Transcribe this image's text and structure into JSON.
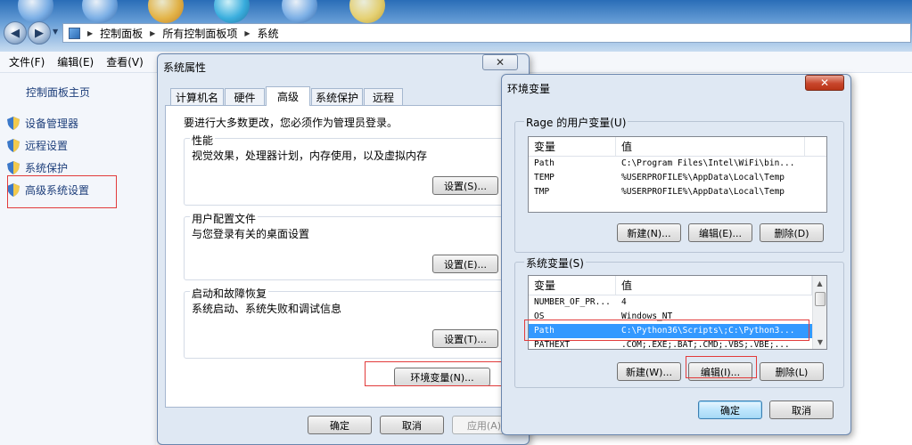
{
  "address_bar": {
    "crumbs": [
      "控制面板",
      "所有控制面板项",
      "系统"
    ]
  },
  "explorer": {
    "menu": [
      "文件(F)",
      "编辑(E)",
      "查看(V)"
    ],
    "sidebar": {
      "home": "控制面板主页",
      "links": [
        "设备管理器",
        "远程设置",
        "系统保护",
        "高级系统设置"
      ]
    }
  },
  "system_properties": {
    "title": "系统属性",
    "close_symbol": "✕",
    "tabs": [
      "计算机名",
      "硬件",
      "高级",
      "系统保护",
      "远程"
    ],
    "active_tab": "高级",
    "admin_note": "要进行大多数更改，您必须作为管理员登录。",
    "performance": {
      "title": "性能",
      "desc": "视觉效果，处理器计划，内存使用，以及虚拟内存",
      "button": "设置(S)..."
    },
    "user_profile": {
      "title": "用户配置文件",
      "desc": "与您登录有关的桌面设置",
      "button": "设置(E)..."
    },
    "startup": {
      "title": "启动和故障恢复",
      "desc": "系统启动、系统失败和调试信息",
      "button": "设置(T)..."
    },
    "env_button": "环境变量(N)...",
    "ok": "确定",
    "cancel": "取消",
    "apply": "应用(A)"
  },
  "env_vars": {
    "title": "环境变量",
    "close_symbol": "✕",
    "user_group": "Rage 的用户变量(U)",
    "columns": {
      "name": "变量",
      "value": "值"
    },
    "user_vars": [
      {
        "name": "Path",
        "value": "C:\\Program Files\\Intel\\WiFi\\bin..."
      },
      {
        "name": "TEMP",
        "value": "%USERPROFILE%\\AppData\\Local\\Temp"
      },
      {
        "name": "TMP",
        "value": "%USERPROFILE%\\AppData\\Local\\Temp"
      }
    ],
    "user_buttons": {
      "new": "新建(N)...",
      "edit": "编辑(E)...",
      "delete": "删除(D)"
    },
    "system_group": "系统变量(S)",
    "system_vars": [
      {
        "name": "NUMBER_OF_PR...",
        "value": "4"
      },
      {
        "name": "OS",
        "value": "Windows_NT"
      },
      {
        "name": "Path",
        "value": "C:\\Python36\\Scripts\\;C:\\Python3..."
      },
      {
        "name": "PATHEXT",
        "value": ".COM;.EXE;.BAT;.CMD;.VBS;.VBE;..."
      }
    ],
    "selected_system_var": "Path",
    "system_buttons": {
      "new": "新建(W)...",
      "edit": "编辑(I)...",
      "delete": "删除(L)"
    },
    "ok": "确定",
    "cancel": "取消"
  },
  "colors": {
    "highlight_box": "#e23b3b",
    "selection": "#3399ff",
    "link": "#1d3e7a"
  }
}
